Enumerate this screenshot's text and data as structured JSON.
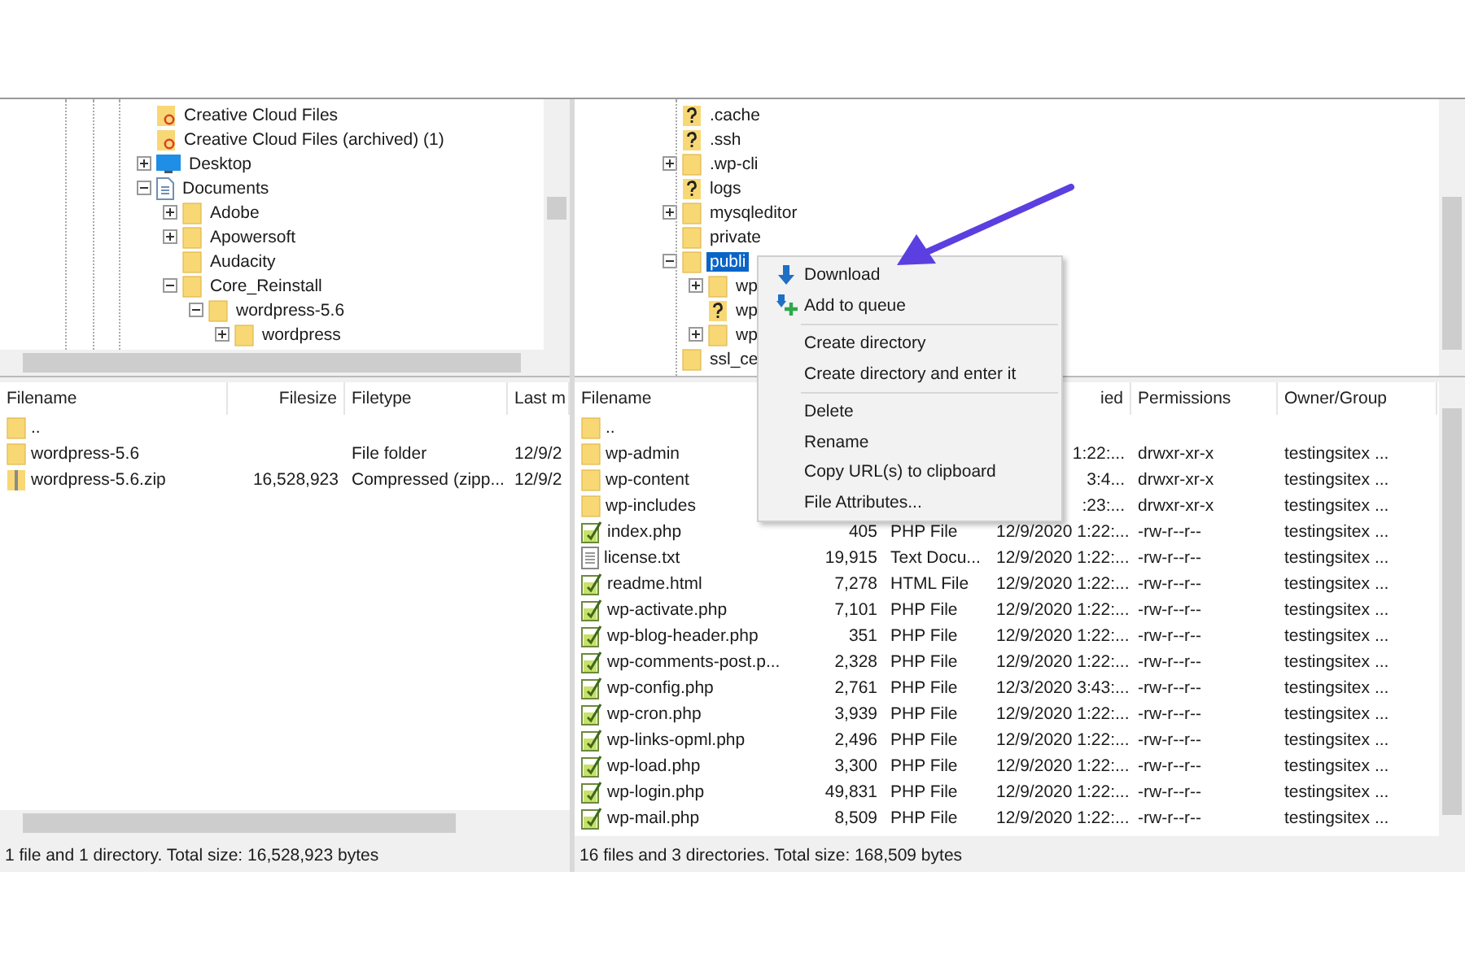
{
  "local": {
    "tree": [
      {
        "label": "Creative Cloud Files",
        "kind": "cloud-folder",
        "selected": false
      },
      {
        "label": "Creative Cloud Files (archived) (1)",
        "kind": "cloud-folder",
        "selected": false
      },
      {
        "label": "Desktop",
        "kind": "desktop",
        "expanded": false,
        "selected": false
      },
      {
        "label": "Documents",
        "kind": "documents",
        "expanded": true,
        "selected": false,
        "children": [
          {
            "label": "Adobe",
            "kind": "folder",
            "expanded": false,
            "selected": false
          },
          {
            "label": "Apowersoft",
            "kind": "folder",
            "expanded": false,
            "selected": false
          },
          {
            "label": "Audacity",
            "kind": "folder",
            "selected": false
          },
          {
            "label": "Core_Reinstall",
            "kind": "folder",
            "expanded": true,
            "selected": false,
            "children": [
              {
                "label": "wordpress-5.6",
                "kind": "folder",
                "expanded": true,
                "selected": false,
                "children": [
                  {
                    "label": "wordpress",
                    "kind": "folder",
                    "expanded": false,
                    "selected": false
                  }
                ]
              }
            ]
          }
        ]
      }
    ],
    "table": {
      "columns": [
        {
          "label": "Filename"
        },
        {
          "label": "Filesize"
        },
        {
          "label": "Filetype"
        },
        {
          "label": "Last m"
        }
      ],
      "rows": [
        {
          "kind": "folder",
          "cells": [
            ".."
          ]
        },
        {
          "kind": "folder",
          "cells": [
            "wordpress-5.6",
            "",
            "File folder",
            "12/9/2"
          ]
        },
        {
          "kind": "zip",
          "cells": [
            "wordpress-5.6.zip",
            "16,528,923",
            "Compressed (zipp...",
            "12/9/2"
          ]
        }
      ]
    },
    "status": "1 file and 1 directory. Total size: 16,528,923 bytes"
  },
  "remote": {
    "tree": [
      {
        "label": ".cache",
        "kind": "unknown",
        "selected": false
      },
      {
        "label": ".ssh",
        "kind": "unknown",
        "selected": false
      },
      {
        "label": ".wp-cli",
        "kind": "folder",
        "expanded": false,
        "selected": false
      },
      {
        "label": "logs",
        "kind": "unknown",
        "selected": false
      },
      {
        "label": "mysqleditor",
        "kind": "folder",
        "expanded": false,
        "selected": false
      },
      {
        "label": "private",
        "kind": "folder",
        "selected": false
      },
      {
        "label": "publi",
        "kind": "folder",
        "expanded": true,
        "selected": true,
        "children": [
          {
            "label": "wp",
            "kind": "folder",
            "expanded": false,
            "selected": false
          },
          {
            "label": "wp",
            "kind": "unknown",
            "selected": false
          },
          {
            "label": "wp",
            "kind": "folder",
            "expanded": false,
            "selected": false
          }
        ]
      },
      {
        "label": "ssl_ce",
        "kind": "folder",
        "selected": false
      }
    ],
    "table": {
      "columns": [
        {
          "label": "Filename"
        },
        {},
        {},
        {
          "label": "ied"
        },
        {
          "label": "Permissions"
        },
        {
          "label": "Owner/Group"
        }
      ],
      "rows": [
        {
          "kind": "folder",
          "cells": [
            ".."
          ]
        },
        {
          "kind": "folder",
          "cells": [
            "wp-admin",
            "",
            "",
            "1:22:...",
            "drwxr-xr-x",
            "testingsitex ..."
          ]
        },
        {
          "kind": "folder",
          "cells": [
            "wp-content",
            "",
            "",
            "3:4...",
            "drwxr-xr-x",
            "testingsitex ..."
          ]
        },
        {
          "kind": "folder",
          "cells": [
            "wp-includes",
            "",
            "",
            ":23:...",
            "drwxr-xr-x",
            "testingsitex ..."
          ]
        },
        {
          "kind": "script",
          "cells": [
            "index.php",
            "405",
            "PHP File",
            "12/9/2020 1:22:...",
            "-rw-r--r--",
            "testingsitex ..."
          ]
        },
        {
          "kind": "text",
          "cells": [
            "license.txt",
            "19,915",
            "Text Docu...",
            "12/9/2020 1:22:...",
            "-rw-r--r--",
            "testingsitex ..."
          ]
        },
        {
          "kind": "script",
          "cells": [
            "readme.html",
            "7,278",
            "HTML File",
            "12/9/2020 1:22:...",
            "-rw-r--r--",
            "testingsitex ..."
          ]
        },
        {
          "kind": "script",
          "cells": [
            "wp-activate.php",
            "7,101",
            "PHP File",
            "12/9/2020 1:22:...",
            "-rw-r--r--",
            "testingsitex ..."
          ]
        },
        {
          "kind": "script",
          "cells": [
            "wp-blog-header.php",
            "351",
            "PHP File",
            "12/9/2020 1:22:...",
            "-rw-r--r--",
            "testingsitex ..."
          ]
        },
        {
          "kind": "script",
          "cells": [
            "wp-comments-post.p...",
            "2,328",
            "PHP File",
            "12/9/2020 1:22:...",
            "-rw-r--r--",
            "testingsitex ..."
          ]
        },
        {
          "kind": "script",
          "cells": [
            "wp-config.php",
            "2,761",
            "PHP File",
            "12/3/2020 3:43:...",
            "-rw-r--r--",
            "testingsitex ..."
          ]
        },
        {
          "kind": "script",
          "cells": [
            "wp-cron.php",
            "3,939",
            "PHP File",
            "12/9/2020 1:22:...",
            "-rw-r--r--",
            "testingsitex ..."
          ]
        },
        {
          "kind": "script",
          "cells": [
            "wp-links-opml.php",
            "2,496",
            "PHP File",
            "12/9/2020 1:22:...",
            "-rw-r--r--",
            "testingsitex ..."
          ]
        },
        {
          "kind": "script",
          "cells": [
            "wp-load.php",
            "3,300",
            "PHP File",
            "12/9/2020 1:22:...",
            "-rw-r--r--",
            "testingsitex ..."
          ]
        },
        {
          "kind": "script",
          "cells": [
            "wp-login.php",
            "49,831",
            "PHP File",
            "12/9/2020 1:22:...",
            "-rw-r--r--",
            "testingsitex ..."
          ]
        },
        {
          "kind": "script",
          "cells": [
            "wp-mail.php",
            "8,509",
            "PHP File",
            "12/9/2020 1:22:...",
            "-rw-r--r--",
            "testingsitex ..."
          ]
        }
      ]
    },
    "status": "16 files and 3 directories. Total size: 168,509 bytes"
  },
  "context_menu": {
    "items": [
      {
        "label": "Download",
        "kind": "download"
      },
      {
        "label": "Add to queue",
        "kind": "queue"
      },
      {
        "kind": "separator"
      },
      {
        "label": "Create directory",
        "kind": "plain"
      },
      {
        "label": "Create directory and enter it",
        "kind": "plain"
      },
      {
        "kind": "separator"
      },
      {
        "label": "Delete",
        "kind": "plain"
      },
      {
        "label": "Rename",
        "kind": "plain"
      },
      {
        "label": "Copy URL(s) to clipboard",
        "kind": "plain"
      },
      {
        "label": "File Attributes...",
        "kind": "plain"
      }
    ]
  }
}
